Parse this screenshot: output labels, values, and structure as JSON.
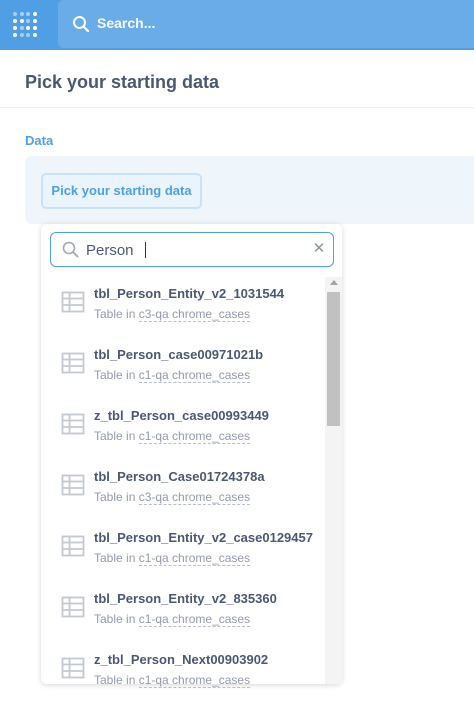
{
  "topbar": {
    "search_placeholder": "Search...",
    "brand_color": "#509ee3"
  },
  "page": {
    "title": "Pick your starting data"
  },
  "data_section": {
    "label": "Data",
    "pick_button": "Pick your starting data"
  },
  "picker": {
    "search_value": "Person",
    "accent": "#509ee3",
    "items": [
      {
        "name": "tbl_Person_Entity_v2_1031544",
        "prefix": "Table in ",
        "db": "c3-qa chrome_cases"
      },
      {
        "name": "tbl_Person_case00971021b",
        "prefix": "Table in ",
        "db": "c1-qa chrome_cases"
      },
      {
        "name": "z_tbl_Person_case00993449",
        "prefix": "Table in ",
        "db": "c1-qa chrome_cases"
      },
      {
        "name": "tbl_Person_Case01724378a",
        "prefix": "Table in ",
        "db": "c3-qa chrome_cases"
      },
      {
        "name": "tbl_Person_Entity_v2_case0129457",
        "prefix": "Table in ",
        "db": "c1-qa chrome_cases"
      },
      {
        "name": "tbl_Person_Entity_v2_835360",
        "prefix": "Table in ",
        "db": "c1-qa chrome_cases"
      },
      {
        "name": "z_tbl_Person_Next00903902",
        "prefix": "Table in ",
        "db": "c1-qa chrome_cases"
      }
    ]
  }
}
